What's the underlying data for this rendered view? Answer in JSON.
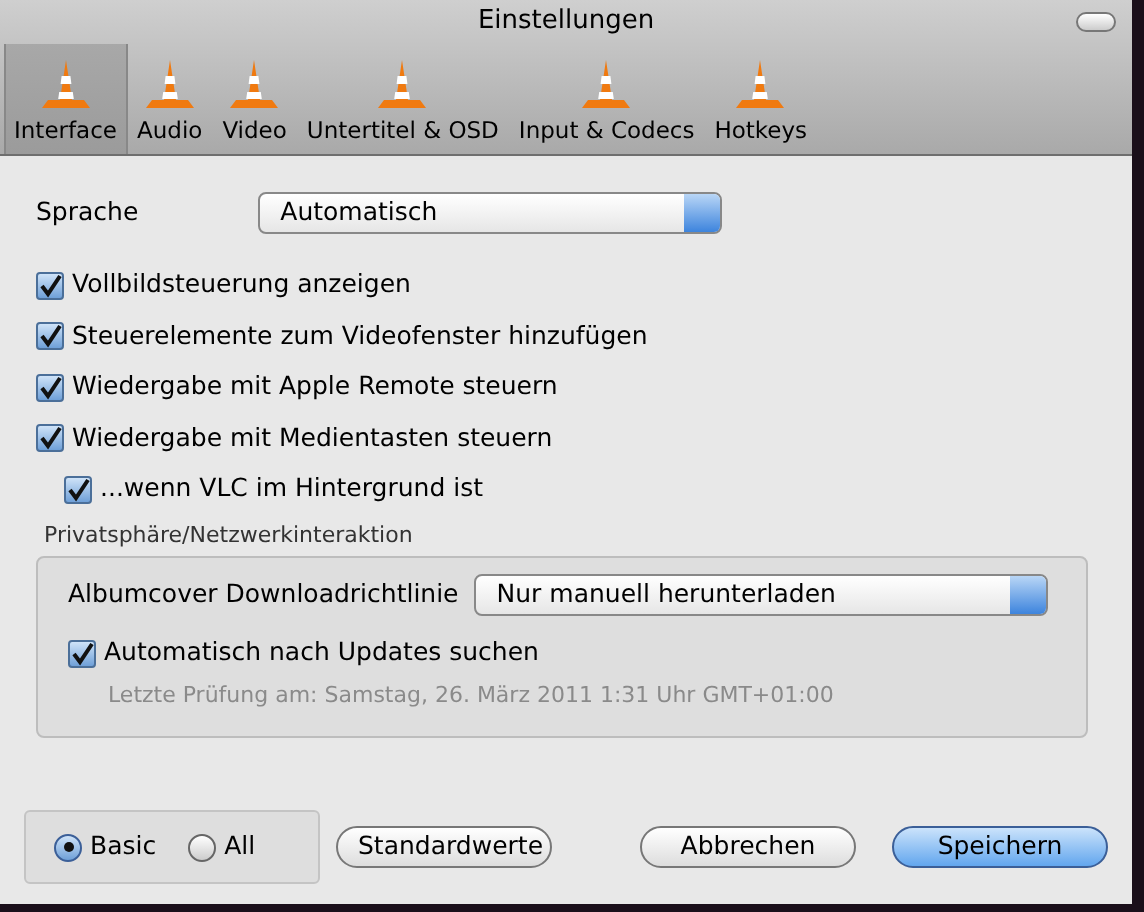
{
  "window": {
    "title": "Einstellungen"
  },
  "tabs": [
    {
      "label": "Interface",
      "selected": true
    },
    {
      "label": "Audio",
      "selected": false
    },
    {
      "label": "Video",
      "selected": false
    },
    {
      "label": "Untertitel & OSD",
      "selected": false
    },
    {
      "label": "Input & Codecs",
      "selected": false
    },
    {
      "label": "Hotkeys",
      "selected": false
    }
  ],
  "language": {
    "label": "Sprache",
    "value": "Automatisch"
  },
  "options": [
    {
      "label": "Vollbildsteuerung anzeigen",
      "checked": true
    },
    {
      "label": "Steuerelemente zum Videofenster hinzufügen",
      "checked": true
    },
    {
      "label": "Wiedergabe mit Apple Remote steuern",
      "checked": true
    },
    {
      "label": "Wiedergabe mit Medientasten steuern",
      "checked": true,
      "children": [
        {
          "label": "...wenn VLC im Hintergrund ist",
          "checked": true
        }
      ]
    }
  ],
  "privacy": {
    "title": "Privatsphäre/Netzwerkinteraktion",
    "album_label": "Albumcover Downloadrichtlinie",
    "album_value": "Nur manuell herunterladen",
    "updates": {
      "label": "Automatisch nach Updates suchen",
      "checked": true
    },
    "last_check": "Letzte Prüfung am: Samstag, 26. März 2011 1:31 Uhr GMT+01:00"
  },
  "view_modes": [
    {
      "label": "Basic",
      "selected": true
    },
    {
      "label": "All",
      "selected": false
    }
  ],
  "buttons": [
    {
      "label": "Standardwerte",
      "kind": "plain"
    },
    {
      "label": "Abbrechen",
      "kind": "plain"
    },
    {
      "label": "Speichern",
      "kind": "default"
    }
  ]
}
